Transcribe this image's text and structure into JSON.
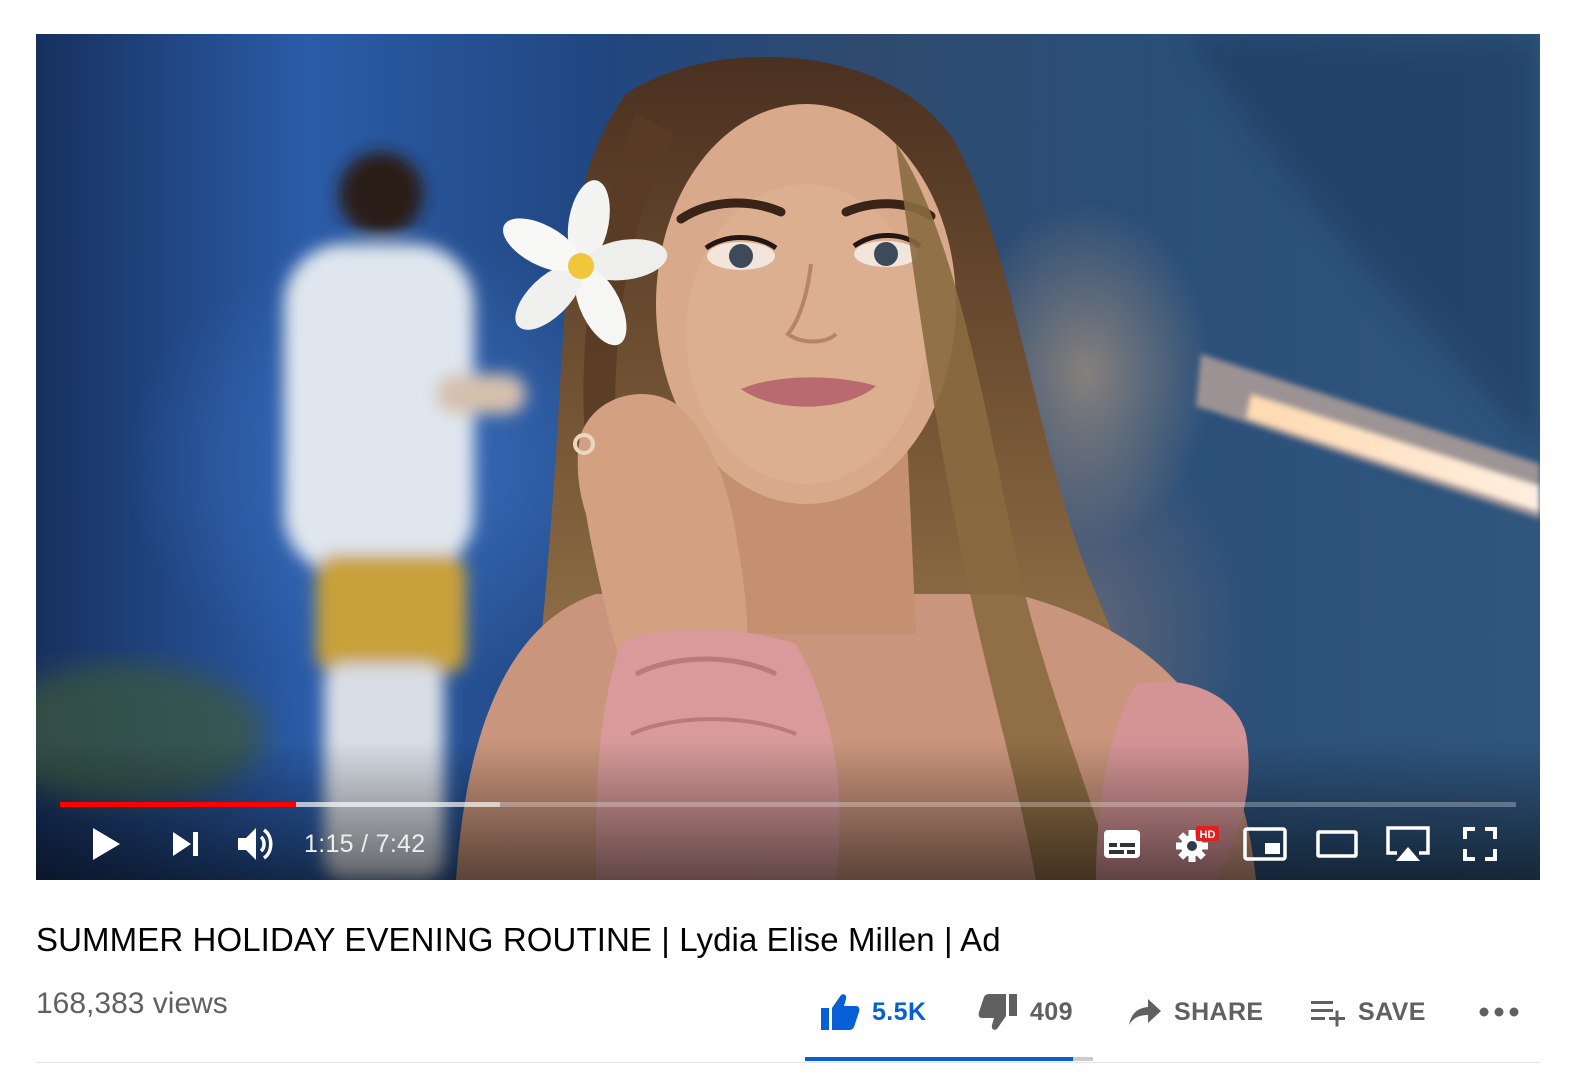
{
  "player": {
    "progress_played": 0.162,
    "progress_buffered": 0.302,
    "time_current": "1:15",
    "time_separator": " / ",
    "time_total": "7:42",
    "hd_badge": "HD",
    "controls": [
      {
        "name": "play-button",
        "icon": "play-icon"
      },
      {
        "name": "next-button",
        "icon": "skip-next-icon"
      },
      {
        "name": "volume-button",
        "icon": "volume-icon"
      },
      {
        "name": "subtitles-button",
        "icon": "subtitles-icon"
      },
      {
        "name": "settings-button",
        "icon": "gear-icon"
      },
      {
        "name": "miniplayer-button",
        "icon": "miniplayer-icon"
      },
      {
        "name": "theater-button",
        "icon": "theater-icon"
      },
      {
        "name": "airplay-button",
        "icon": "airplay-icon"
      },
      {
        "name": "fullscreen-button",
        "icon": "fullscreen-icon"
      }
    ]
  },
  "video": {
    "title": "SUMMER HOLIDAY EVENING ROUTINE | Lydia Elise Millen | Ad",
    "views": "168,383 views"
  },
  "actions": {
    "like_count": "5.5K",
    "dislike_count": "409",
    "share_label": "SHARE",
    "save_label": "SAVE",
    "like_ratio": 0.93
  },
  "colors": {
    "accent_blue": "#065fd4",
    "progress_red": "#ff0000",
    "text_primary": "#030303",
    "text_secondary": "#606060"
  }
}
